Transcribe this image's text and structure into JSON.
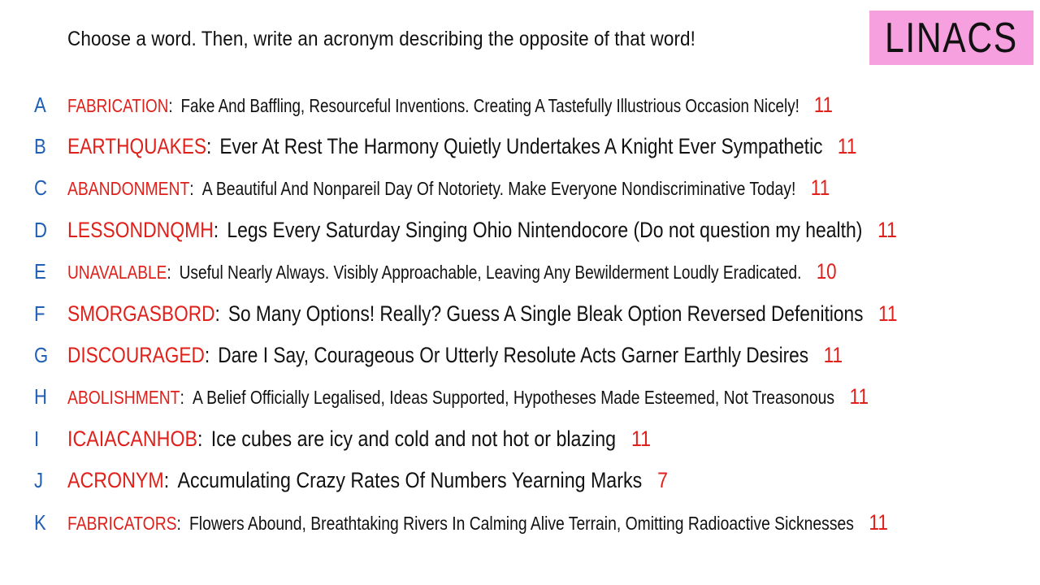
{
  "prompt": "Choose a word. Then, write an acronym describing the opposite of that word!",
  "logo": "LINACS",
  "colors": {
    "word": "#e0201b",
    "letter": "#1f5fb4",
    "logo_bg": "#f7a0e0",
    "text": "#111111"
  },
  "entries": [
    {
      "letter": "A",
      "word": "FABRICATION",
      "phrase": "Fake And Baffling, Resourceful Inventions. Creating A Tastefully Illustrious Occasion Nicely!",
      "count": "11"
    },
    {
      "letter": "B",
      "word": "EARTHQUAKES",
      "phrase": "Ever At Rest The Harmony Quietly Undertakes A Knight Ever Sympathetic",
      "count": "11"
    },
    {
      "letter": "C",
      "word": "ABANDONMENT",
      "phrase": "A Beautiful And Nonpareil Day Of Notoriety. Make Everyone Nondiscriminative Today!",
      "count": "11"
    },
    {
      "letter": "D",
      "word": "LESSONDNQMH",
      "phrase": "Legs Every Saturday Singing Ohio Nintendocore (Do not question my health)",
      "count": "11"
    },
    {
      "letter": "E",
      "word": "UNAVALABLE",
      "phrase": "Useful Nearly Always. Visibly Approachable, Leaving Any Bewilderment Loudly Eradicated.",
      "count": "10"
    },
    {
      "letter": "F",
      "word": "SMORGASBORD",
      "phrase": "So Many Options! Really? Guess A Single Bleak Option Reversed Defenitions",
      "count": "11"
    },
    {
      "letter": "G",
      "word": "DISCOURAGED",
      "phrase": "Dare I Say, Courageous Or Utterly Resolute Acts Garner Earthly Desires",
      "count": "11"
    },
    {
      "letter": "H",
      "word": "ABOLISHMENT",
      "phrase": "A Belief Officially Legalised, Ideas Supported, Hypotheses Made Esteemed, Not Treasonous",
      "count": "11"
    },
    {
      "letter": "I",
      "word": "ICAIACANHOB",
      "phrase": "Ice cubes are icy and cold and not hot or blazing",
      "count": "11"
    },
    {
      "letter": "J",
      "word": "ACRONYM",
      "phrase": "Accumulating Crazy Rates Of Numbers Yearning Marks",
      "count": "7"
    },
    {
      "letter": "K",
      "word": "FABRICATORS",
      "phrase": "Flowers Abound, Breathtaking Rivers In Calming Alive Terrain, Omitting Radioactive Sicknesses",
      "count": "11"
    }
  ]
}
